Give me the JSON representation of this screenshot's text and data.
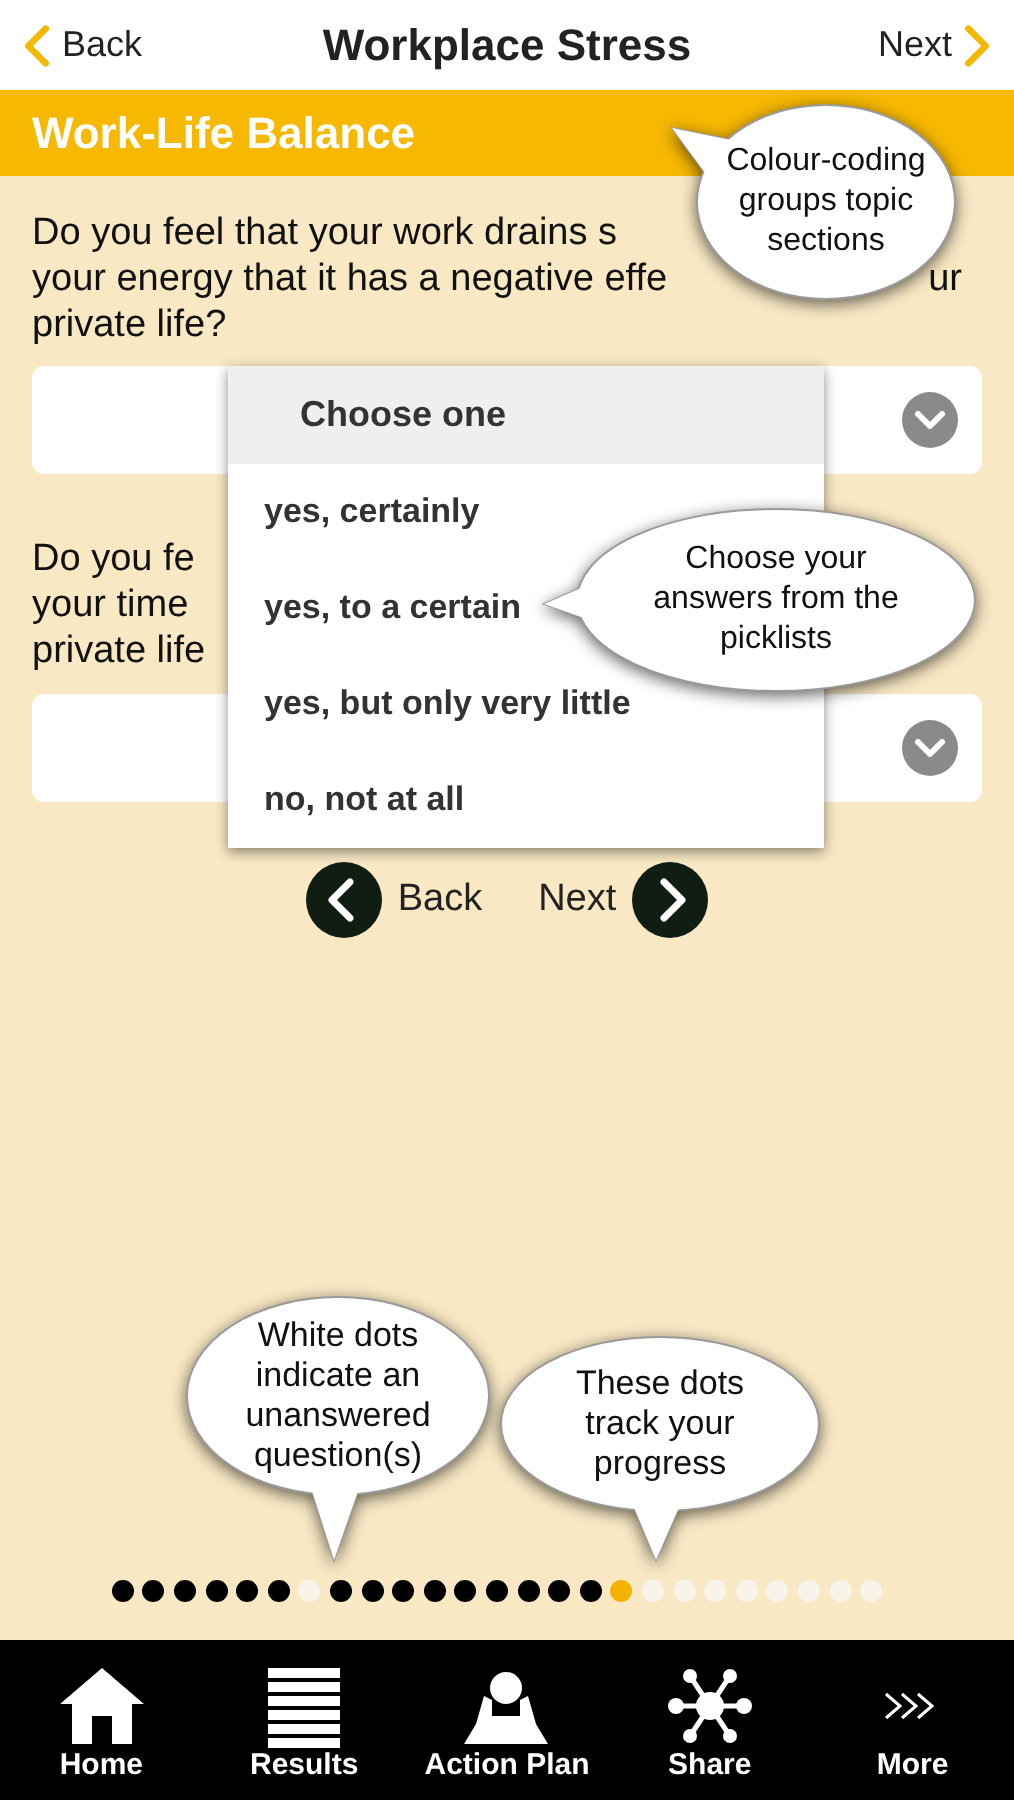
{
  "header": {
    "back": "Back",
    "title": "Workplace Stress",
    "next": "Next"
  },
  "section": {
    "title": "Work-Life Balance"
  },
  "questions": [
    {
      "lines": [
        {
          "text": "Do you feel that your work drains s"
        },
        {
          "text": "your energy that it has a negative effe",
          "tail": "ur"
        },
        {
          "text": "private life?"
        }
      ]
    },
    {
      "lines": [
        {
          "text": "Do you fe"
        },
        {
          "text": "your time"
        },
        {
          "text": "private life"
        }
      ]
    }
  ],
  "picklist": {
    "header": "Choose one",
    "options": [
      "yes, certainly",
      "yes, to a certain",
      "yes, but only very little",
      "no, not at all"
    ]
  },
  "nav": {
    "back": "Back",
    "next": "Next"
  },
  "callouts": [
    {
      "lines": [
        "Colour-coding",
        "groups topic",
        "sections"
      ]
    },
    {
      "lines": [
        "Choose your",
        "answers from the",
        "picklists"
      ]
    },
    {
      "lines": [
        "White dots",
        "indicate an",
        "unanswered",
        "question(s)"
      ]
    },
    {
      "lines": [
        "These dots",
        "track your",
        "progress"
      ]
    }
  ],
  "dots": [
    {
      "answered": true,
      "selected": false
    },
    {
      "answered": true,
      "selected": false
    },
    {
      "answered": true,
      "selected": false
    },
    {
      "answered": true,
      "selected": false
    },
    {
      "answered": true,
      "selected": false
    },
    {
      "answered": true,
      "selected": false
    },
    {
      "answered": false,
      "selected": false
    },
    {
      "answered": true,
      "selected": false
    },
    {
      "answered": true,
      "selected": false
    },
    {
      "answered": true,
      "selected": false
    },
    {
      "answered": true,
      "selected": false
    },
    {
      "answered": true,
      "selected": false
    },
    {
      "answered": true,
      "selected": false
    },
    {
      "answered": true,
      "selected": false
    },
    {
      "answered": true,
      "selected": false
    },
    {
      "answered": true,
      "selected": false
    },
    {
      "answered": false,
      "selected": true
    },
    {
      "answered": false,
      "selected": false
    },
    {
      "answered": false,
      "selected": false
    },
    {
      "answered": false,
      "selected": false
    },
    {
      "answered": false,
      "selected": false
    },
    {
      "answered": false,
      "selected": false
    },
    {
      "answered": false,
      "selected": false
    },
    {
      "answered": false,
      "selected": false
    },
    {
      "answered": false,
      "selected": false
    }
  ],
  "tabs": [
    {
      "kind": "home",
      "label": "Home"
    },
    {
      "kind": "results",
      "label": "Results"
    },
    {
      "kind": "action",
      "label": "Action Plan"
    },
    {
      "kind": "share",
      "label": "Share"
    },
    {
      "kind": "more",
      "label": "More"
    }
  ]
}
